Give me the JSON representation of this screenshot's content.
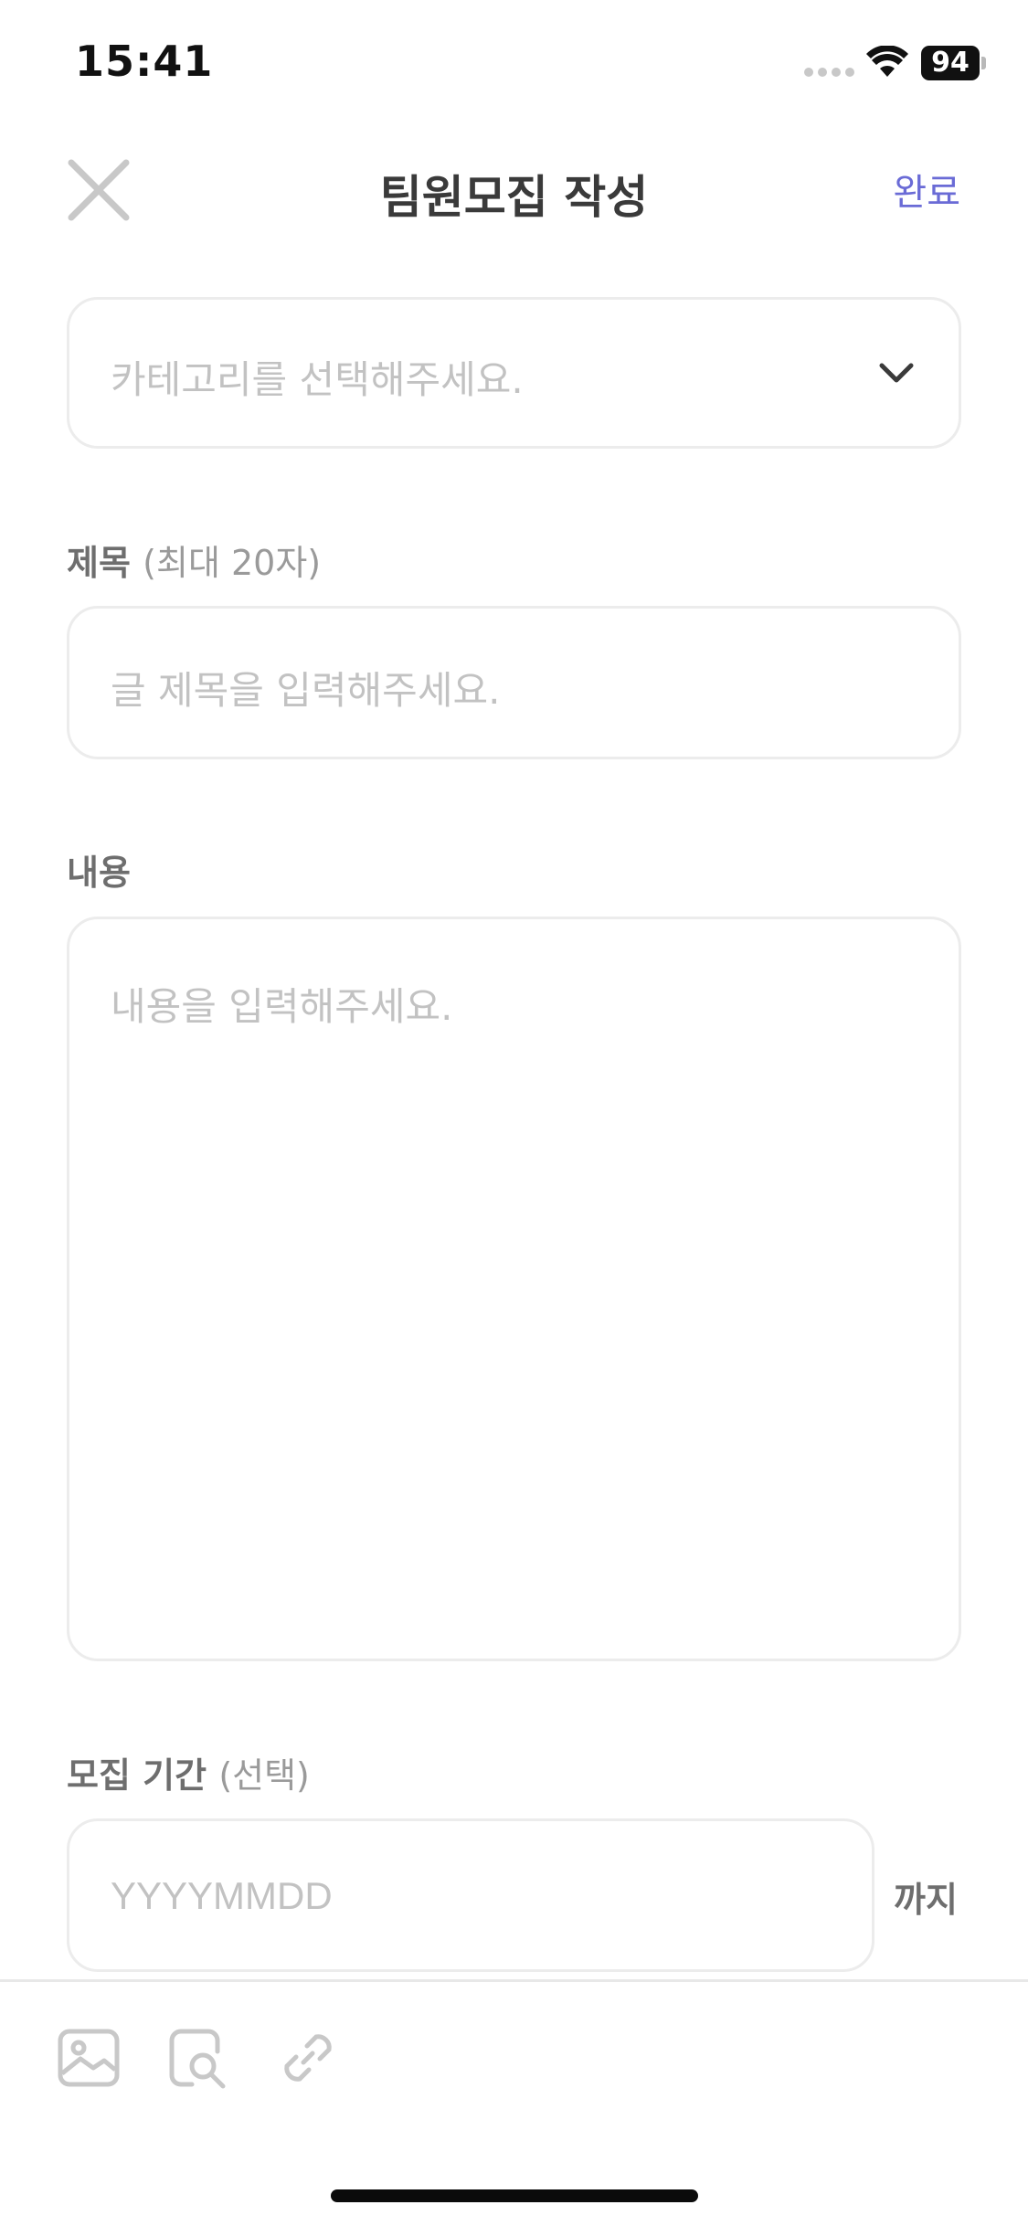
{
  "status_bar": {
    "time": "15:41",
    "battery": "94",
    "icons": [
      "signal-dots-icon",
      "wifi-icon",
      "battery-icon"
    ]
  },
  "header": {
    "close_icon": "close-icon",
    "title": "팀원모집 작성",
    "done_label": "완료",
    "accent_color": "#6a6bd6"
  },
  "form": {
    "category": {
      "placeholder": "카테고리를 선택해주세요.",
      "icon": "chevron-down-icon"
    },
    "title": {
      "label": "제목",
      "sub_label": "(최대 20자)",
      "placeholder": "글 제목을 입력해주세요."
    },
    "content": {
      "label": "내용",
      "placeholder": "내용을 입력해주세요."
    },
    "period": {
      "label": "모집 기간",
      "sub_label": "(선택)",
      "placeholder": "YYYYMMDD",
      "suffix": "까지"
    }
  },
  "toolbar": {
    "items": [
      {
        "icon": "image-icon"
      },
      {
        "icon": "search-document-icon"
      },
      {
        "icon": "link-icon"
      }
    ]
  }
}
